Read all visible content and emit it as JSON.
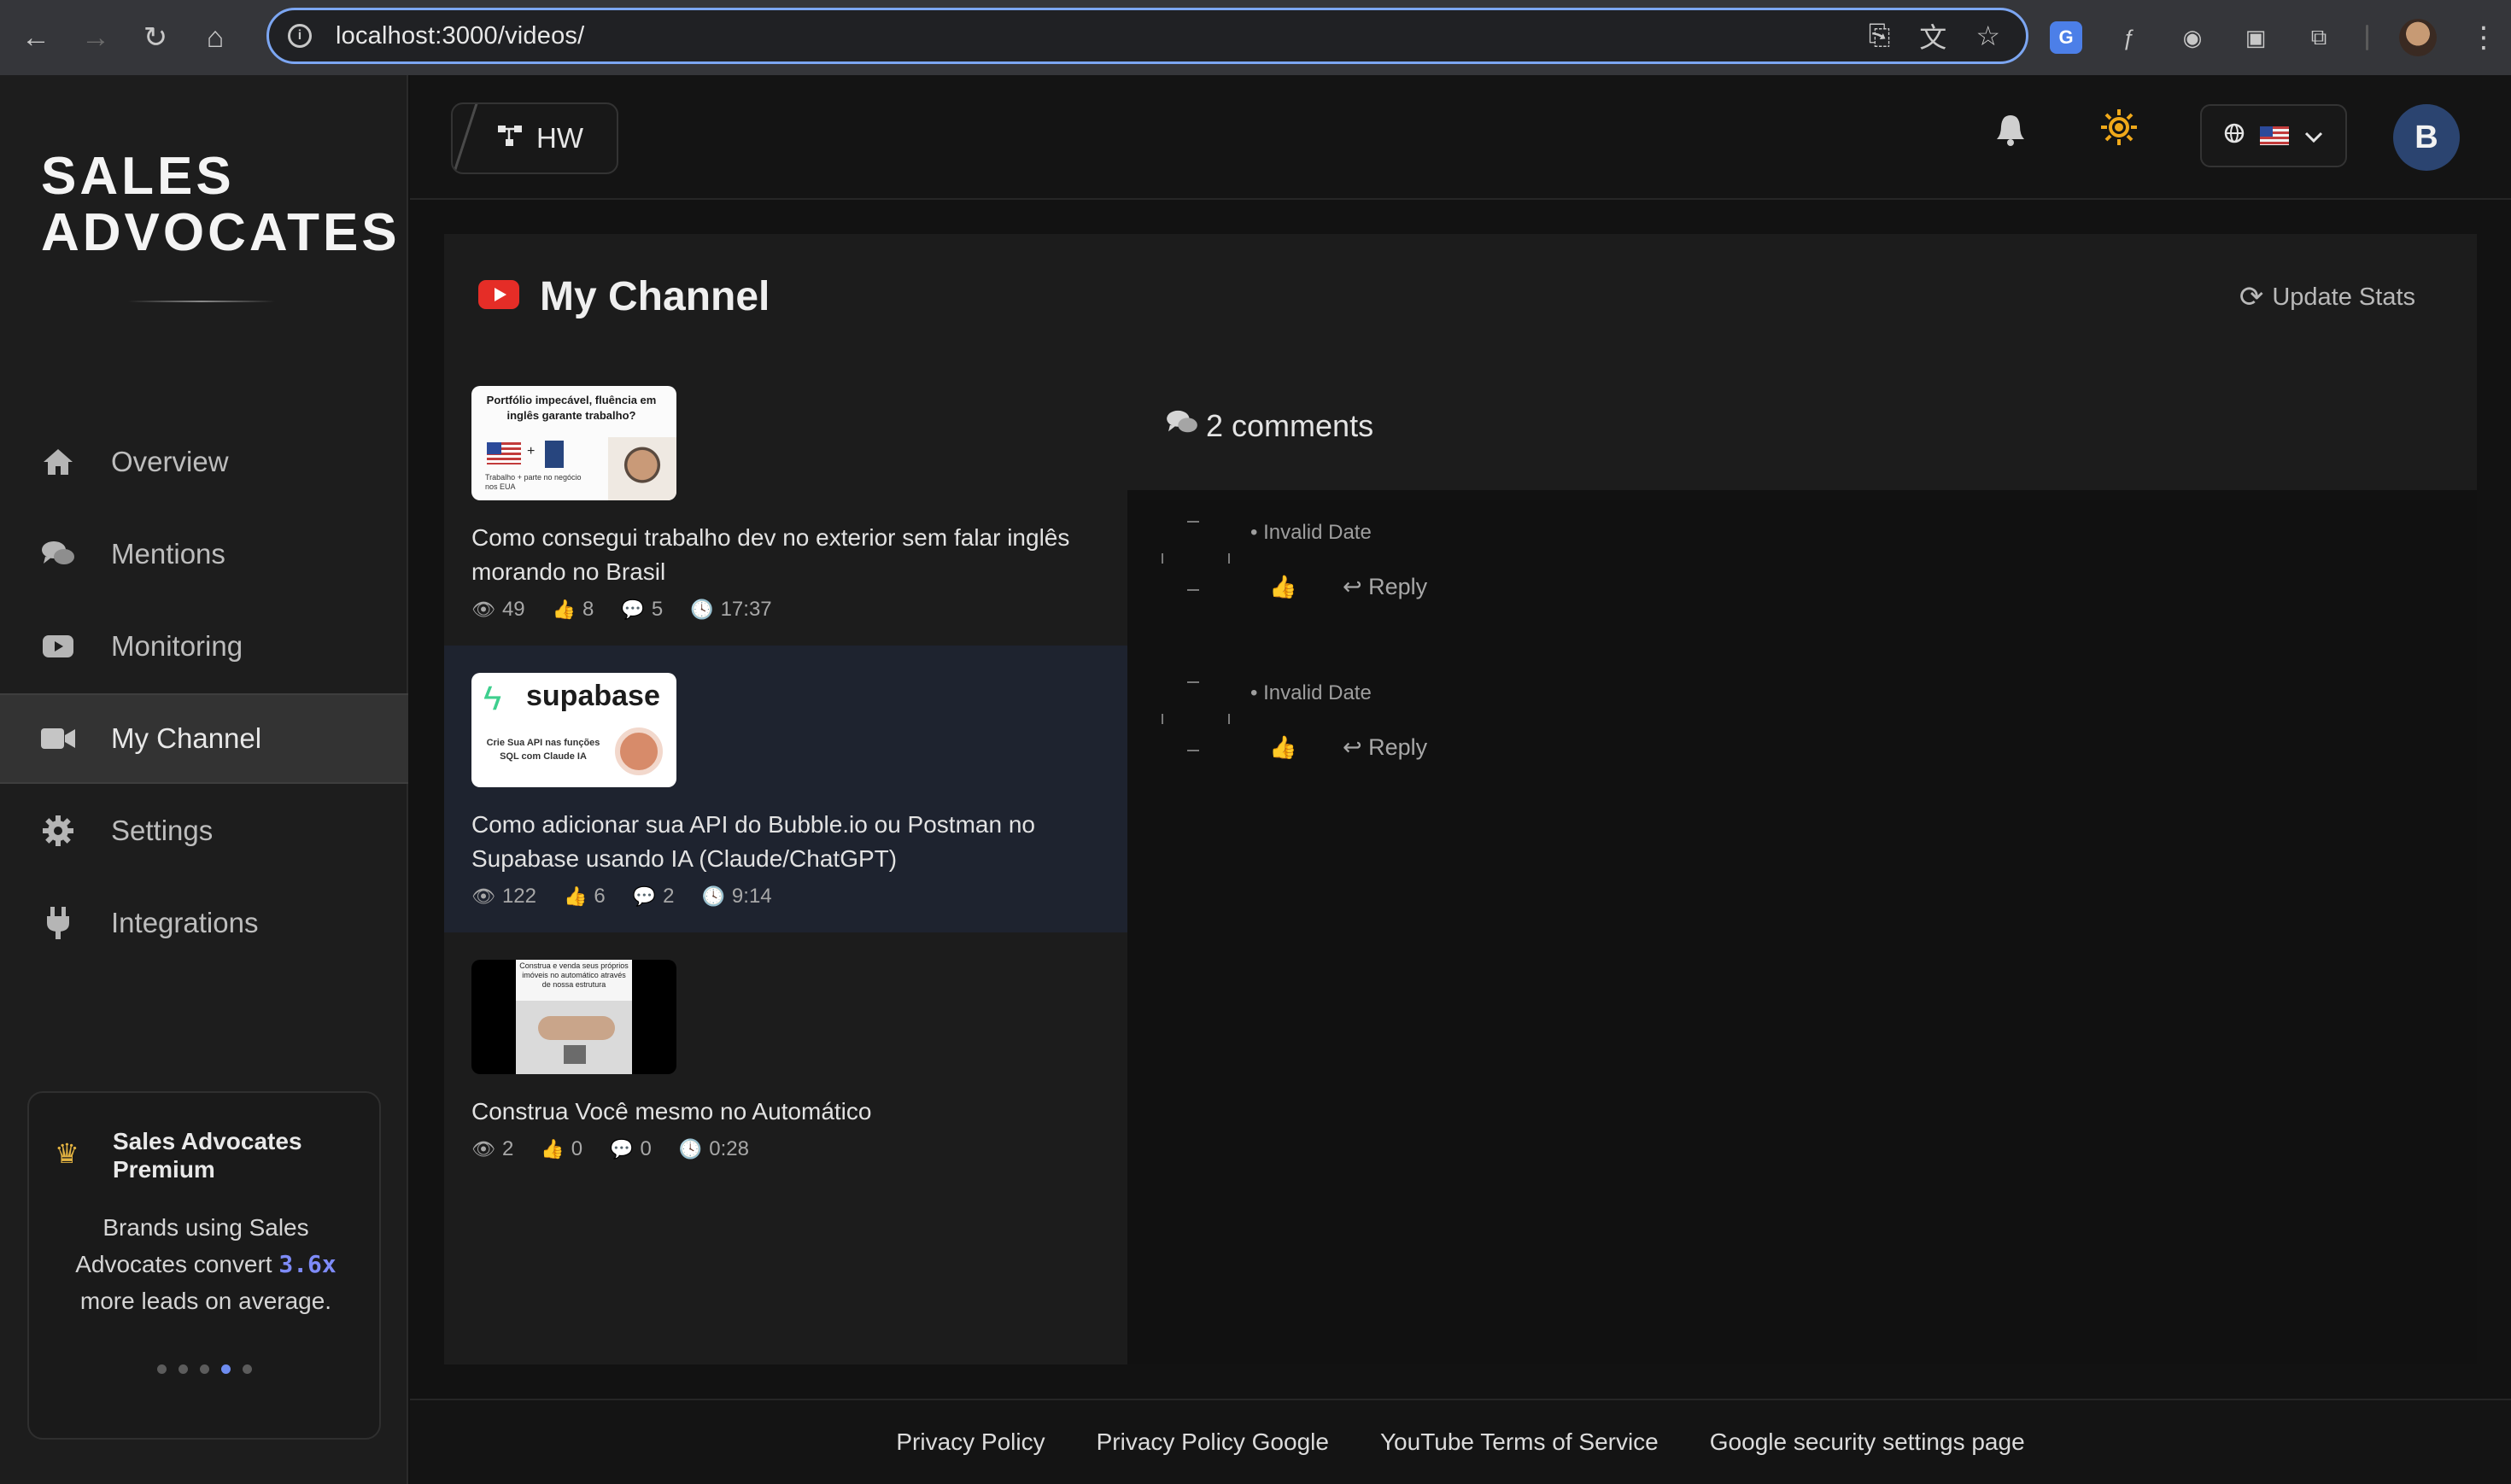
{
  "browser": {
    "url": "localhost:3000/videos/",
    "icons": [
      "back-icon",
      "forward-icon",
      "reload-icon",
      "home-icon",
      "site-info-icon",
      "install-app-icon",
      "translate-icon",
      "bookmark-star-icon"
    ],
    "extensions": [
      "google-translate-ext-icon",
      "formula-ext-icon",
      "camera-ext-icon",
      "chrome-ext-icon",
      "extensions-puzzle-icon",
      "profile-avatar-icon",
      "more-menu-icon"
    ]
  },
  "sidebar": {
    "brand_line1": "SALES",
    "brand_line2": "ADVOCATES",
    "items": [
      {
        "label": "Overview",
        "icon": "home-icon"
      },
      {
        "label": "Mentions",
        "icon": "comments-icon"
      },
      {
        "label": "Monitoring",
        "icon": "youtube-icon"
      },
      {
        "label": "My Channel",
        "icon": "video-camera-icon",
        "active": true
      },
      {
        "label": "Settings",
        "icon": "gear-icon"
      },
      {
        "label": "Integrations",
        "icon": "plug-icon"
      }
    ],
    "premium": {
      "title": "Sales Advocates Premium",
      "text_before": "Brands using Sales Advocates convert ",
      "highlight": "3.6x",
      "text_after": " more leads on average.",
      "dots_total": 5,
      "dot_active": 4
    }
  },
  "topbar": {
    "workspace": "HW",
    "language_flag": "us-flag-icon"
  },
  "user": {
    "initial": "B"
  },
  "main": {
    "title": "My Channel",
    "update_label": "Update Stats",
    "videos": [
      {
        "title": "Como consegui trabalho dev no exterior sem falar inglês morando no Brasil",
        "views": "49",
        "likes": "8",
        "comments": "5",
        "duration": "17:37",
        "thumb_text": "Portfólio impecável, fluência em inglês garante trabalho?",
        "thumb_small": "Trabalho + parte no negócio nos EUA"
      },
      {
        "title": "Como adicionar sua API do Bubble.io ou Postman no Supabase usando IA (Claude/ChatGPT)",
        "views": "122",
        "likes": "6",
        "comments": "2",
        "duration": "9:14",
        "thumb_brand": "supabase",
        "thumb_text": "Crie Sua API nas funções SQL com Claude IA",
        "active": true
      },
      {
        "title": "Construa Você mesmo no Automático",
        "views": "2",
        "likes": "0",
        "comments": "0",
        "duration": "0:28",
        "thumb_text": "Construa e venda seus próprios imóveis no automático através de nossa estrutura"
      }
    ],
    "comments_header": "2 comments",
    "comments": [
      {
        "date": "• Invalid Date",
        "reply": "Reply"
      },
      {
        "date": "• Invalid Date",
        "reply": "Reply"
      }
    ]
  },
  "footer": {
    "links": [
      "Privacy Policy",
      "Privacy Policy Google",
      "YouTube Terms of Service",
      "Google security settings page"
    ]
  },
  "colors": {
    "accent_blue": "#7e8bf8",
    "youtube_red": "#e52d27",
    "sun_orange": "#f0a91a",
    "active_video_bg": "#1e232f"
  }
}
